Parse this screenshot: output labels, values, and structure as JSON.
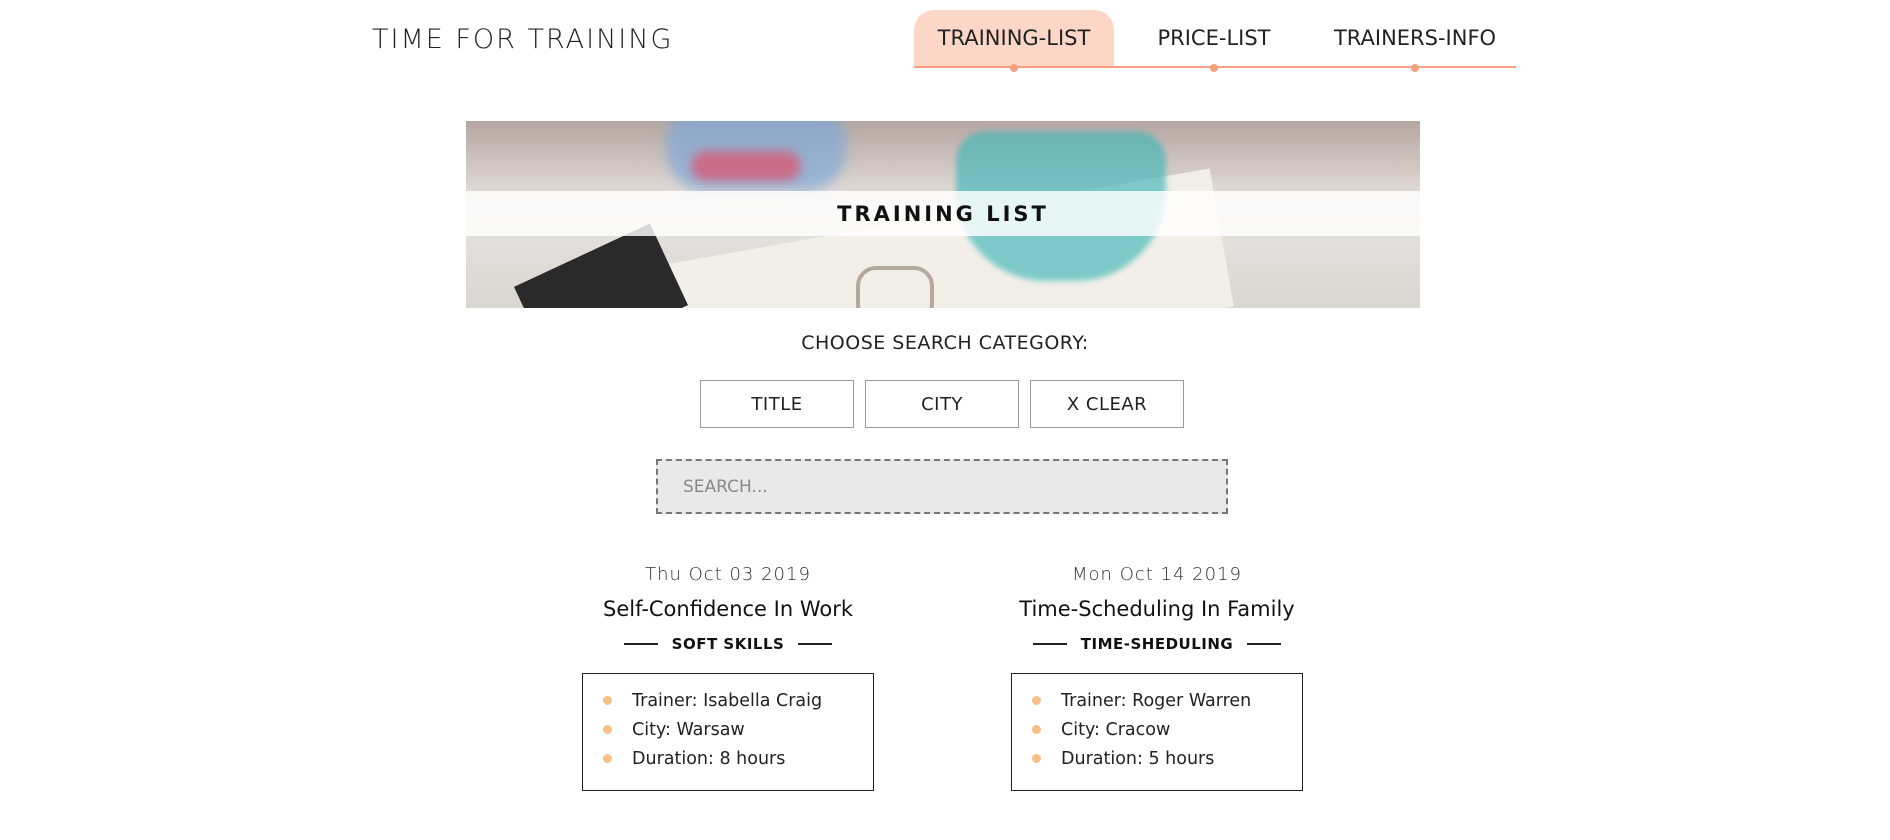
{
  "header": {
    "logo": "TIME FOR TRAINING",
    "nav": [
      {
        "label": "TRAINING-LIST",
        "active": true
      },
      {
        "label": "PRICE-LIST",
        "active": false
      },
      {
        "label": "TRAINERS-INFO",
        "active": false
      }
    ]
  },
  "banner": {
    "title": "TRAINING LIST"
  },
  "search": {
    "label": "CHOOSE SEARCH CATEGORY:",
    "buttons": [
      "TITLE",
      "CITY",
      "X CLEAR"
    ],
    "placeholder": "SEARCH..."
  },
  "trainings": [
    {
      "date": "Thu Oct 03 2019",
      "title": "Self-Confidence In Work",
      "category": "SOFT SKILLS",
      "trainer": "Trainer: Isabella Craig",
      "city": "City: Warsaw",
      "duration": "Duration: 8 hours"
    },
    {
      "date": "Mon Oct 14 2019",
      "title": "Time-Scheduling In Family",
      "category": "TIME-SHEDULING",
      "trainer": "Trainer: Roger Warren",
      "city": "City: Cracow",
      "duration": "Duration: 5 hours"
    }
  ],
  "colors": {
    "accent": "#f2a07e",
    "active_tab": "#fcd6c6",
    "bullet": "#f5c08a",
    "search_bg": "#e9e9e9"
  }
}
